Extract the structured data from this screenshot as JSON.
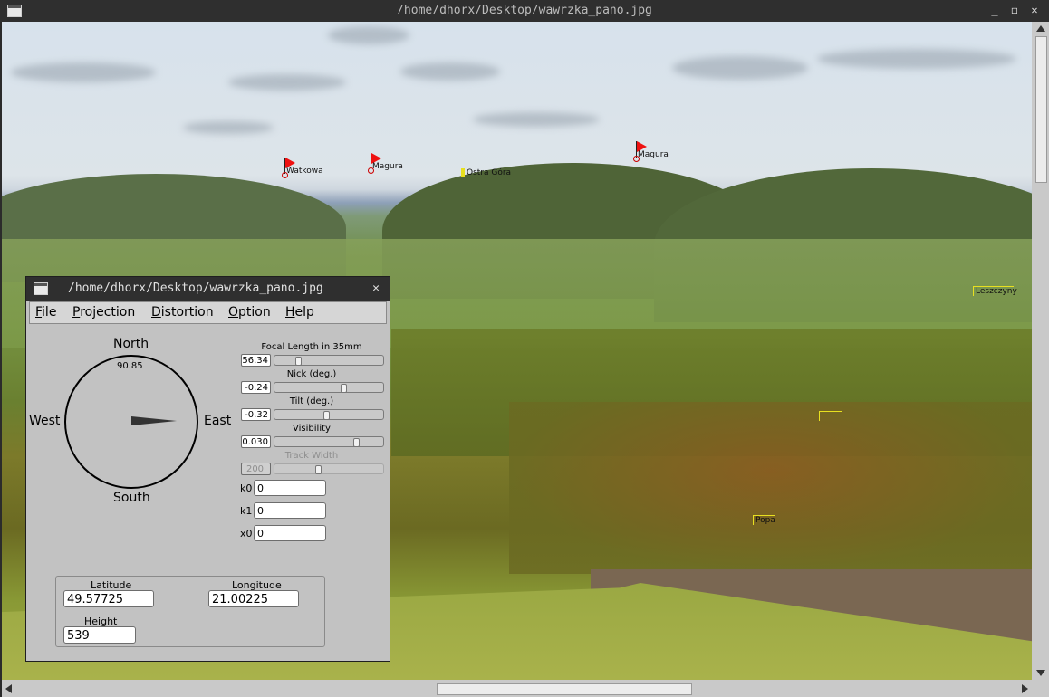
{
  "window": {
    "title": "/home/dhorx/Desktop/wawrzka_pano.jpg",
    "buttons": {
      "minimize": "_",
      "maximize": "◻",
      "close": "✕"
    }
  },
  "panorama": {
    "flags": [
      {
        "label": "Watkowa"
      },
      {
        "label": "Magura"
      },
      {
        "label": "Magura"
      }
    ],
    "markers": [
      {
        "label": "Ostra Góra"
      },
      {
        "label": "Leszczyny"
      },
      {
        "label": ""
      },
      {
        "label": "Popa"
      }
    ]
  },
  "dialog": {
    "title": "/home/dhorx/Desktop/wawrzka_pano.jpg",
    "close": "✕",
    "menu": [
      {
        "label": "File",
        "key": "F",
        "rest": "ile"
      },
      {
        "label": "Projection",
        "key": "P",
        "rest": "rojection"
      },
      {
        "label": "Distortion",
        "key": "D",
        "rest": "istortion"
      },
      {
        "label": "Option",
        "key": "O",
        "rest": "ption"
      },
      {
        "label": "Help",
        "key": "H",
        "rest": "elp"
      }
    ],
    "compass": {
      "north": "North",
      "south": "South",
      "east": "East",
      "west": "West",
      "heading": "90.85"
    },
    "params": [
      {
        "label": "Focal Length in 35mm",
        "value": "56.34",
        "position": 0.2,
        "enabled": true
      },
      {
        "label": "Nick (deg.)",
        "value": "-0.24",
        "position": 0.65,
        "enabled": true
      },
      {
        "label": "Tilt (deg.)",
        "value": "-0.32",
        "position": 0.48,
        "enabled": true
      },
      {
        "label": "Visibility",
        "value": "0.030",
        "position": 0.77,
        "enabled": true
      },
      {
        "label": "Track Width",
        "value": "200",
        "position": 0.4,
        "enabled": false
      }
    ],
    "distortion": [
      {
        "label": "k0",
        "value": "0"
      },
      {
        "label": "k1",
        "value": "0"
      },
      {
        "label": "x0",
        "value": "0"
      }
    ],
    "location": {
      "latitude_label": "Latitude",
      "latitude": "49.57725",
      "longitude_label": "Longitude",
      "longitude": "21.00225",
      "height_label": "Height",
      "height": "539"
    }
  },
  "colors": {
    "titlebar": "#2f2f2f",
    "dialog_bg": "#c2c2c2",
    "flag": "#ee1111",
    "marker": "#e8e020"
  }
}
